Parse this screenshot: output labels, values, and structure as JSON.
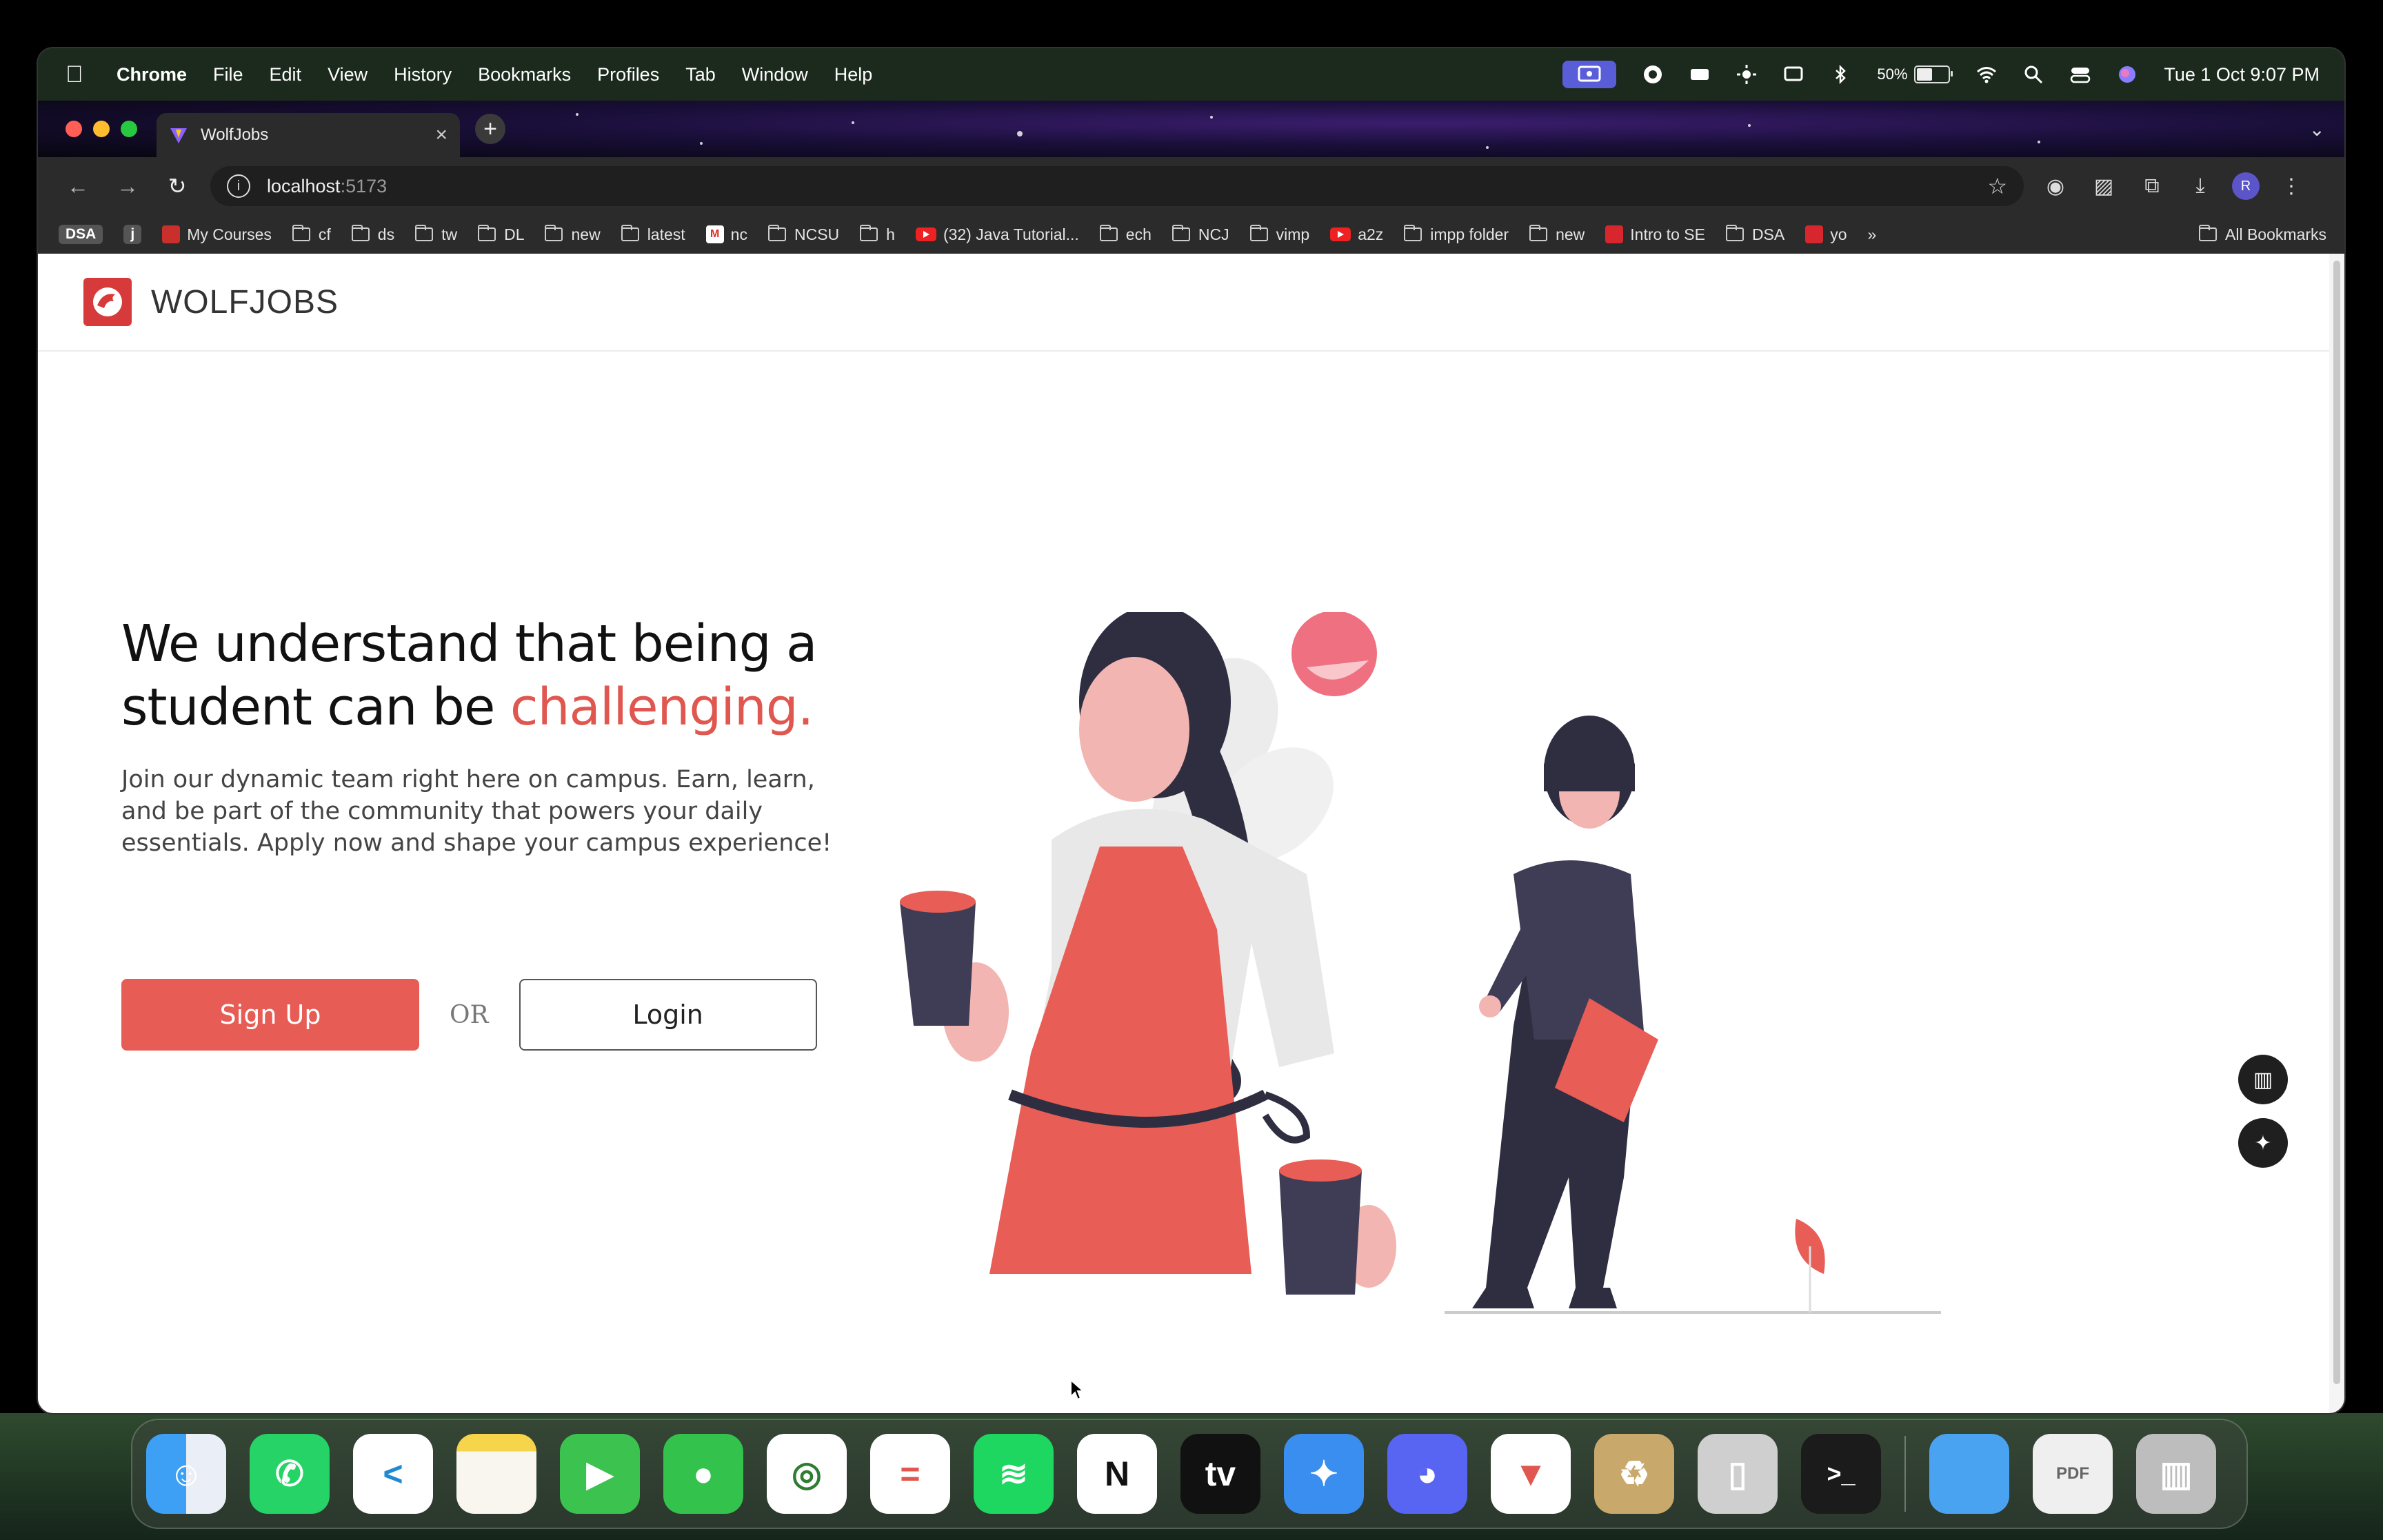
{
  "menubar": {
    "app_name": "Chrome",
    "menus": [
      "File",
      "Edit",
      "View",
      "History",
      "Bookmarks",
      "Profiles",
      "Tab",
      "Window",
      "Help"
    ],
    "battery_percent": "50%",
    "battery_level": 0.5,
    "datetime": "Tue 1 Oct  9:07 PM"
  },
  "browser": {
    "tab_title": "WolfJobs",
    "url_host": "localhost",
    "url_port": ":5173",
    "profile_initial": "R"
  },
  "bookmarks": {
    "items": [
      {
        "label": "DSA",
        "icon": "badge"
      },
      {
        "label": "j",
        "icon": "badge"
      },
      {
        "label": "My Courses",
        "icon": "site"
      },
      {
        "label": "cf",
        "icon": "folder"
      },
      {
        "label": "ds",
        "icon": "folder"
      },
      {
        "label": "tw",
        "icon": "folder"
      },
      {
        "label": "DL",
        "icon": "folder"
      },
      {
        "label": "new",
        "icon": "folder"
      },
      {
        "label": "latest",
        "icon": "folder"
      },
      {
        "label": "nc",
        "icon": "gmail"
      },
      {
        "label": "NCSU",
        "icon": "folder"
      },
      {
        "label": "h",
        "icon": "folder"
      },
      {
        "label": "(32) Java Tutorial...",
        "icon": "youtube"
      },
      {
        "label": "ech",
        "icon": "folder"
      },
      {
        "label": "NCJ",
        "icon": "folder"
      },
      {
        "label": "vimp",
        "icon": "folder"
      },
      {
        "label": "a2z",
        "icon": "youtube"
      },
      {
        "label": "impp folder",
        "icon": "folder"
      },
      {
        "label": "new",
        "icon": "folder"
      },
      {
        "label": "Intro to SE",
        "icon": "se"
      },
      {
        "label": "DSA",
        "icon": "folder"
      },
      {
        "label": "yo",
        "icon": "acrobat"
      }
    ],
    "overflow": "»",
    "all_bookmarks": "All Bookmarks"
  },
  "site": {
    "logo_text": "WOLFJOBS",
    "headline_part1": "We understand that being a student can be ",
    "headline_accent": "challenging.",
    "subtext": "Join our dynamic team right here on campus. Earn, learn, and be part of the community that powers your daily essentials. Apply now and shape your campus experience!",
    "signup_label": "Sign Up",
    "or_label": "OR",
    "login_label": "Login"
  },
  "colors": {
    "accent": "#e75d55",
    "brand": "#d63a3a"
  },
  "dock": {
    "apps": [
      "finder-icon",
      "whatsapp-icon",
      "vscode-icon",
      "notes-icon",
      "facetime-icon",
      "messages-icon",
      "chrome-icon",
      "calculator-icon",
      "spotify-icon",
      "notion-icon",
      "appletv-icon",
      "safari-icon",
      "discord-icon",
      "brave-icon",
      "archive-icon",
      "iphone-mirroring-icon",
      "terminal-icon",
      "files-folder-icon",
      "pdf-document-icon",
      "trash-icon"
    ]
  }
}
